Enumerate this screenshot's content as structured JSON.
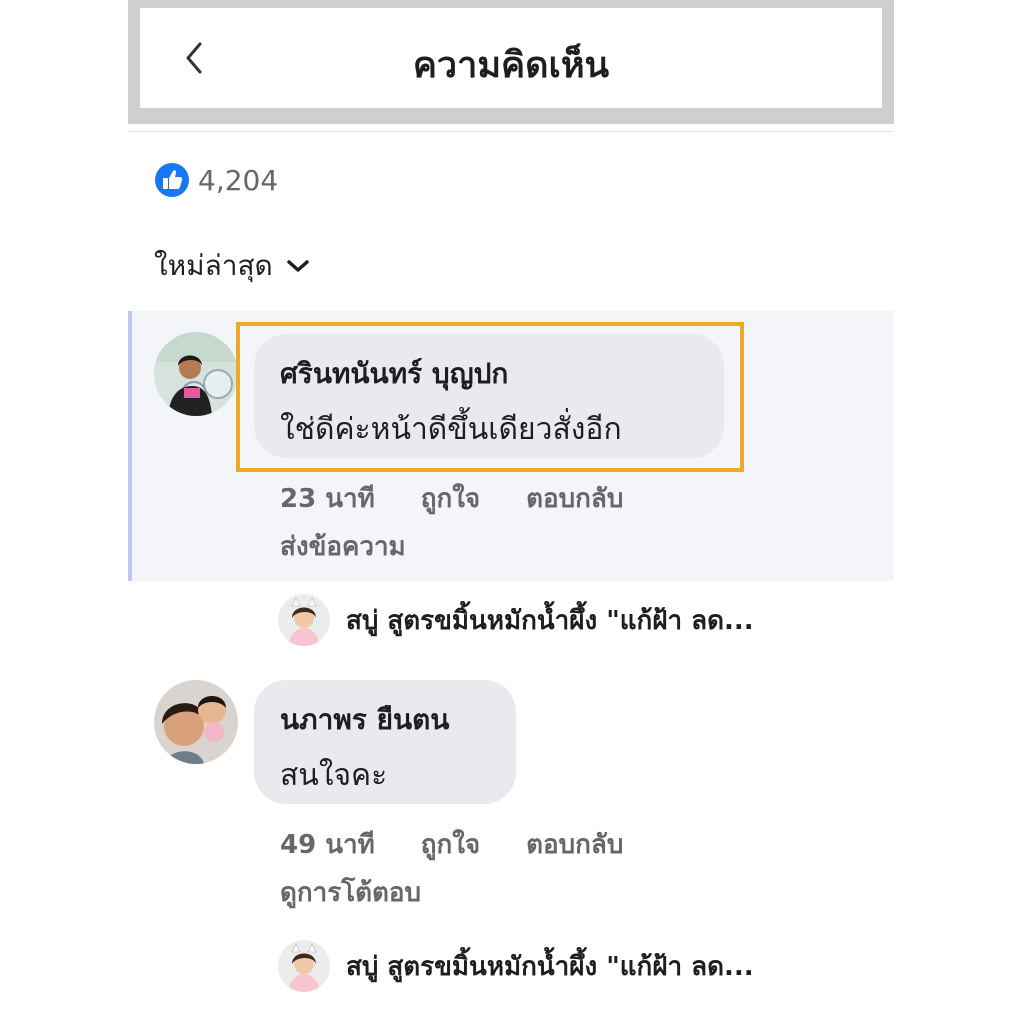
{
  "header": {
    "title": "ความคิดเห็น"
  },
  "reactions": {
    "count": "4,204"
  },
  "sort": {
    "label": "ใหม่ล่าสุด"
  },
  "comments": [
    {
      "author": "ศรินทนันทร์ บุญปก",
      "text": "ใช่ดีค่ะหน้าดีขึ้นเดียวสั่งอีก",
      "time": "23 นาที",
      "like_label": "ถูกใจ",
      "reply_label": "ตอบกลับ",
      "extra_link": "ส่งข้อความ",
      "reply_preview": "สบู่ สูตรขมิ้นหมักน้ำผึ้ง \"แก้ฝ้า ลด...",
      "highlighted": true
    },
    {
      "author": "นภาพร ยืนตน",
      "text": "สนใจคะ",
      "time": "49 นาที",
      "like_label": "ถูกใจ",
      "reply_label": "ตอบกลับ",
      "extra_link": "ดูการโต้ตอบ",
      "reply_preview": "สบู่ สูตรขมิ้นหมักน้ำผึ้ง \"แก้ฝ้า ลด...",
      "highlighted": false
    }
  ],
  "colors": {
    "accent_like": "#1877f2",
    "highlight_border": "#f0a923",
    "bubble": "#e9eaee",
    "meta_text": "#65676b"
  },
  "icons": {
    "back": "chevron-left-icon",
    "like": "thumbs-up-icon",
    "sort": "chevron-down-icon"
  }
}
